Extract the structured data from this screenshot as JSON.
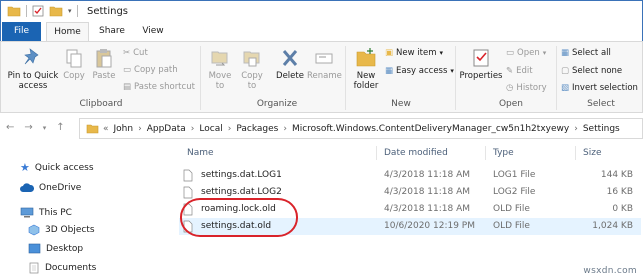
{
  "window": {
    "title": "Settings"
  },
  "menu": {
    "file": "File",
    "home": "Home",
    "share": "Share",
    "view": "View"
  },
  "ribbon": {
    "clipboard": {
      "pin": "Pin to Quick access",
      "copy": "Copy",
      "paste": "Paste",
      "cut": "Cut",
      "copy_path": "Copy path",
      "paste_shortcut": "Paste shortcut",
      "label": "Clipboard"
    },
    "organize": {
      "move_to": "Move to",
      "copy_to": "Copy to",
      "delete": "Delete",
      "rename": "Rename",
      "label": "Organize"
    },
    "new": {
      "new_folder": "New folder",
      "new_item": "New item",
      "easy_access": "Easy access",
      "label": "New"
    },
    "open": {
      "properties": "Properties",
      "open": "Open",
      "edit": "Edit",
      "history": "History",
      "label": "Open"
    },
    "select": {
      "select_all": "Select all",
      "select_none": "Select none",
      "invert_selection": "Invert selection",
      "label": "Select"
    }
  },
  "address": {
    "crumbs": [
      "John",
      "AppData",
      "Local",
      "Packages",
      "Microsoft.Windows.ContentDeliveryManager_cw5n1h2txyewy",
      "Settings"
    ]
  },
  "nav": {
    "quick_access": "Quick access",
    "onedrive": "OneDrive",
    "this_pc": "This PC",
    "objects_3d": "3D Objects",
    "desktop": "Desktop",
    "documents": "Documents"
  },
  "columns": {
    "name": "Name",
    "date": "Date modified",
    "type": "Type",
    "size": "Size"
  },
  "files": [
    {
      "name": "settings.dat.LOG1",
      "date": "4/3/2018 11:18 AM",
      "type": "LOG1 File",
      "size": "144 KB"
    },
    {
      "name": "settings.dat.LOG2",
      "date": "4/3/2018 11:18 AM",
      "type": "LOG2 File",
      "size": "16 KB"
    },
    {
      "name": "roaming.lock.old",
      "date": "4/3/2018 11:18 AM",
      "type": "OLD File",
      "size": "0 KB"
    },
    {
      "name": "settings.dat.old",
      "date": "10/6/2020 12:19 PM",
      "type": "OLD File",
      "size": "1,024 KB"
    }
  ],
  "watermark": "wsxdn.com",
  "colors": {
    "accent": "#1b64b3",
    "highlight": "#d9232a",
    "selection": "#e5f3ff",
    "folder": "#e8b84a"
  }
}
